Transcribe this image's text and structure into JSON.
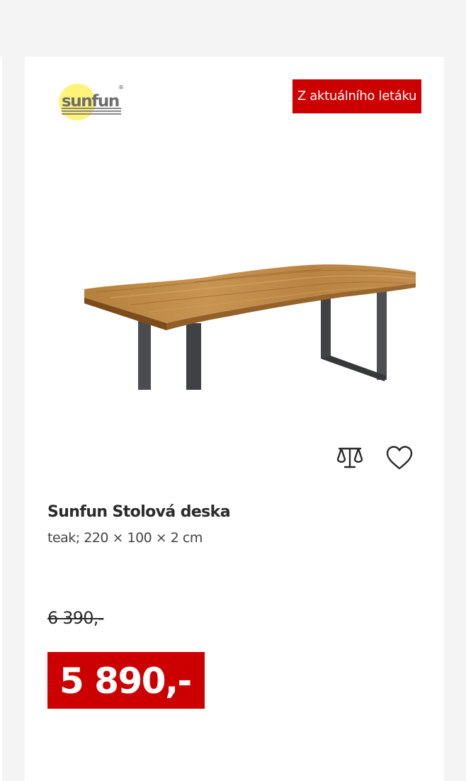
{
  "product": {
    "brand_logo_text": "sunfun",
    "badge": "Z aktuálního letáku",
    "title": "Sunfun Stolová deska",
    "description": "teak; 220 × 100 × 2 cm",
    "old_price": "6 390,-",
    "price": "5 890,-"
  },
  "icons": {
    "compare": "scale-icon",
    "wishlist": "heart-icon"
  },
  "colors": {
    "accent": "#cc0000",
    "page_background": "#f4f4f4",
    "card_background": "#ffffff",
    "text": "#2b2b2b"
  }
}
